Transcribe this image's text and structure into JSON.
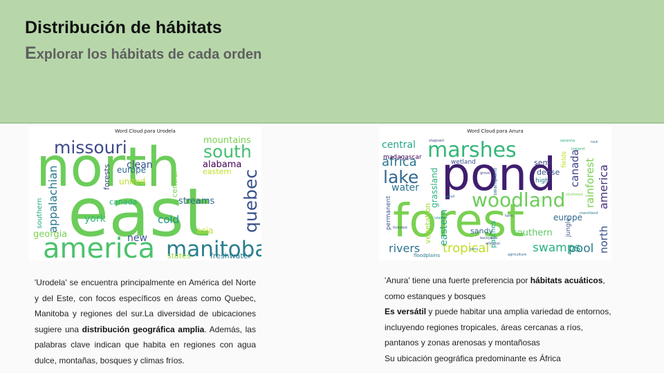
{
  "slide": {
    "title": "Distribución de hábitats",
    "subtitle_first": "E",
    "subtitle_rest": "xplorar los hábitats de cada orden"
  },
  "left": {
    "cloud_title": "Word Cloud para Urodela",
    "words": [
      {
        "text": "north",
        "color": "#6ccd5a"
      },
      {
        "text": "east",
        "color": "#6ccd5a"
      },
      {
        "text": "america",
        "color": "#4cc26c"
      },
      {
        "text": "manitoba",
        "color": "#2b7f8e"
      },
      {
        "text": "missouri",
        "color": "#3e4a89"
      },
      {
        "text": "south",
        "color": "#44bf70"
      },
      {
        "text": "quebec",
        "color": "#3b528b"
      },
      {
        "text": "appalachian",
        "color": "#2a788e"
      },
      {
        "text": "mountains",
        "color": "#7ad151"
      },
      {
        "text": "alabama",
        "color": "#440154"
      },
      {
        "text": "eastern",
        "color": "#bddf26"
      },
      {
        "text": "clean",
        "color": "#3b528b"
      },
      {
        "text": "europe",
        "color": "#31688e"
      },
      {
        "text": "united",
        "color": "#bddf26"
      },
      {
        "text": "forests",
        "color": "#414487"
      },
      {
        "text": "central",
        "color": "#7ad151"
      },
      {
        "text": "canada",
        "color": "#2ab07f"
      },
      {
        "text": "streams",
        "color": "#31688e"
      },
      {
        "text": "york",
        "color": "#35b779"
      },
      {
        "text": "cold",
        "color": "#20928c"
      },
      {
        "text": "asia",
        "color": "#bddf26"
      },
      {
        "text": "new",
        "color": "#3b528b"
      },
      {
        "text": "georgia",
        "color": "#7ad151"
      },
      {
        "text": "southern",
        "color": "#22a884"
      },
      {
        "text": "states",
        "color": "#a0da39"
      },
      {
        "text": "freshwater",
        "color": "#2a788e"
      }
    ],
    "text_1": "'Urodela' se encuentra principalmente en América del Norte y del Este, con focos específicos en áreas como Quebec, Manitoba y regiones del sur.La diversidad de ubicaciones sugiere una ",
    "text_bold": "distribución geográfica amplia",
    "text_2": ". Además, las palabras clave indican que habita en regiones con agua dulce, montañas, bosques y climas fríos."
  },
  "right": {
    "cloud_title": "Word Cloud para Anura",
    "words": [
      {
        "text": "pond",
        "color": "#3f1e6e"
      },
      {
        "text": "forest",
        "color": "#7ad151"
      },
      {
        "text": "marshes",
        "color": "#35b779"
      },
      {
        "text": "woodland",
        "color": "#6ccd5a"
      },
      {
        "text": "lake",
        "color": "#31688e"
      },
      {
        "text": "africa",
        "color": "#2a788e"
      },
      {
        "text": "central",
        "color": "#22a884"
      },
      {
        "text": "water",
        "color": "#2c728e"
      },
      {
        "text": "grassland",
        "color": "#2ab07f"
      },
      {
        "text": "canada",
        "color": "#414487"
      },
      {
        "text": "america",
        "color": "#46327e"
      },
      {
        "text": "rainforest",
        "color": "#7ad151"
      },
      {
        "text": "north",
        "color": "#3b528b"
      },
      {
        "text": "rivers",
        "color": "#2c728e"
      },
      {
        "text": "tropical",
        "color": "#bddf26"
      },
      {
        "text": "swamps",
        "color": "#2ab07f"
      },
      {
        "text": "pool",
        "color": "#2a788e"
      },
      {
        "text": "southern",
        "color": "#5ec962"
      },
      {
        "text": "europe",
        "color": "#31688e"
      },
      {
        "text": "eastern",
        "color": "#22a884"
      },
      {
        "text": "vegetation",
        "color": "#a0da39"
      },
      {
        "text": "permanent",
        "color": "#3b528b"
      },
      {
        "text": "patches",
        "color": "#22a884"
      },
      {
        "text": "sandy",
        "color": "#31688e"
      },
      {
        "text": "dense",
        "color": "#3b528b"
      },
      {
        "text": "semi",
        "color": "#414487"
      },
      {
        "text": "madagascar",
        "color": "#440154"
      },
      {
        "text": "wetland",
        "color": "#3b528b"
      },
      {
        "text": "swampland",
        "color": "#31688e"
      },
      {
        "text": "jungle",
        "color": "#3b528b"
      },
      {
        "text": "fields",
        "color": "#bddf26"
      },
      {
        "text": "high",
        "color": "#2a788e"
      },
      {
        "text": "floodplains",
        "color": "#2a788e"
      },
      {
        "text": "stagnant",
        "color": "#414487"
      },
      {
        "text": "island",
        "color": "#20928c"
      },
      {
        "text": "small",
        "color": "#2a788e"
      },
      {
        "text": "forested",
        "color": "#3b528b"
      },
      {
        "text": "arboreal",
        "color": "#3b528b"
      },
      {
        "text": "peru",
        "color": "#2c728e"
      },
      {
        "text": "grove",
        "color": "#414487"
      },
      {
        "text": "savanna",
        "color": "#22a884"
      },
      {
        "text": "rock",
        "color": "#31688e"
      },
      {
        "text": "farm",
        "color": "#3b528b"
      },
      {
        "text": "lowland",
        "color": "#35b779"
      },
      {
        "text": "backyards",
        "color": "#3b528b"
      },
      {
        "text": "marshland",
        "color": "#2a788e"
      },
      {
        "text": "southeast",
        "color": "#7ad151"
      },
      {
        "text": "agriculture",
        "color": "#31688e"
      }
    ],
    "text_1": "'Anura' tiene una fuerte preferencia por ",
    "text_bold_1": "hábitats acuáticos",
    "text_2": ", como estanques y bosques",
    "text_3_bold": "Es versátil",
    "text_3": " y puede habitar una amplia variedad de entornos, incluyendo regiones tropicales, áreas cercanas a ríos, pantanos y zonas arenosas y montañosas",
    "text_4": "Su ubicación geográfica predominante es África"
  }
}
